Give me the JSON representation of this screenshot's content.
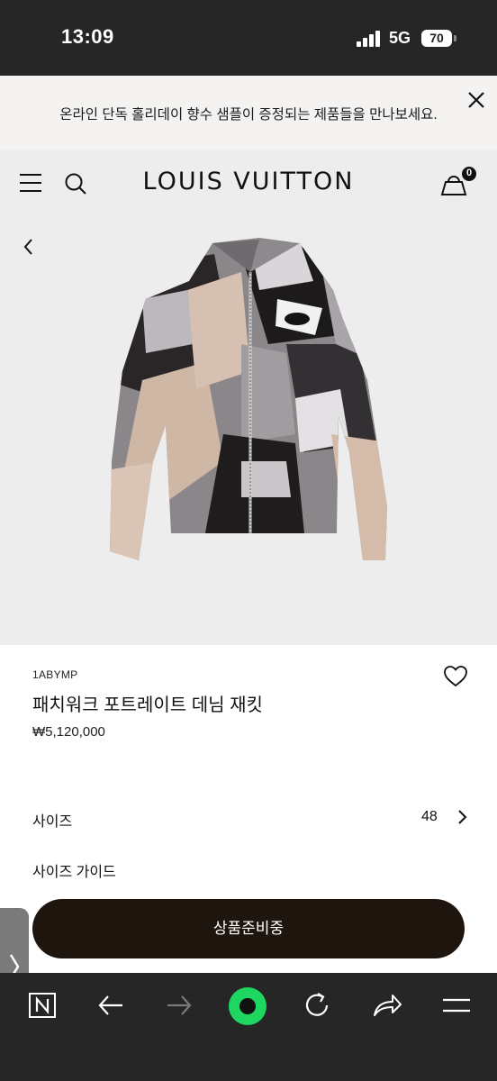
{
  "status_bar": {
    "time": "13:09",
    "network": "5G",
    "battery": "70"
  },
  "promo": {
    "text": "온라인 단독 홀리데이 향수 샘플이 증정되는 제품들을 만나보세요."
  },
  "header": {
    "logo": "LOUIS VUITTON",
    "cart_count": "0"
  },
  "product": {
    "sku": "1ABYMP",
    "title": "패치워크 포트레이트 데님 재킷",
    "price": "₩5,120,000",
    "size_label": "사이즈",
    "size_value": "48",
    "size_guide_label": "사이즈 가이드",
    "cta_label": "상품준비중"
  },
  "browser_bar": {
    "icons": [
      "naver-n-icon",
      "back-arrow-icon",
      "forward-arrow-icon",
      "green-dot-icon",
      "refresh-icon",
      "share-icon",
      "menu-icon"
    ]
  },
  "colors": {
    "cta_bg": "#1f150f",
    "status_bg": "#262626",
    "hero_bg": "#ededed",
    "accent_green": "#1ed760"
  }
}
